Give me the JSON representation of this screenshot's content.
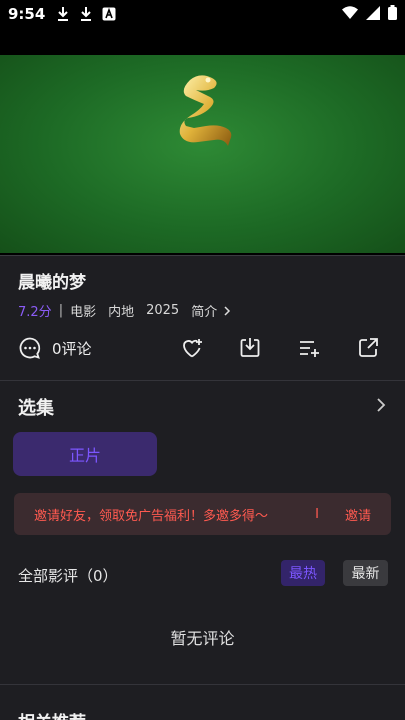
{
  "status_bar": {
    "time": "9:54",
    "icons": [
      "download-icon",
      "download-icon",
      "app-badge-icon",
      "wifi-icon",
      "signal-icon",
      "battery-icon"
    ]
  },
  "video": {
    "background_color": "#1d6a25"
  },
  "movie": {
    "title": "晨曦的梦",
    "score": "7.2分",
    "separator": "|",
    "genre": "电影",
    "region": "内地",
    "year": "2025",
    "intro_label": "简介"
  },
  "actions": {
    "comments_label": "0评论",
    "icons": [
      "comment-icon",
      "favorite-icon",
      "download-icon",
      "add-to-list-icon",
      "share-icon"
    ]
  },
  "episodes": {
    "title": "选集",
    "items": [
      "正片"
    ]
  },
  "banner": {
    "text": "邀请好友，领取免广告福利！多邀多得～",
    "bar": "I",
    "link": "邀请"
  },
  "reviews": {
    "title": "全部影评（0）",
    "tab_hot": "最热",
    "tab_new": "最新",
    "empty": "暂无评论"
  },
  "related": {
    "title": "相关推荐"
  },
  "colors": {
    "accent": "#7c56ff",
    "score": "#8b5cf6",
    "banner_text": "#ff5a50",
    "background": "#1e1e22"
  }
}
